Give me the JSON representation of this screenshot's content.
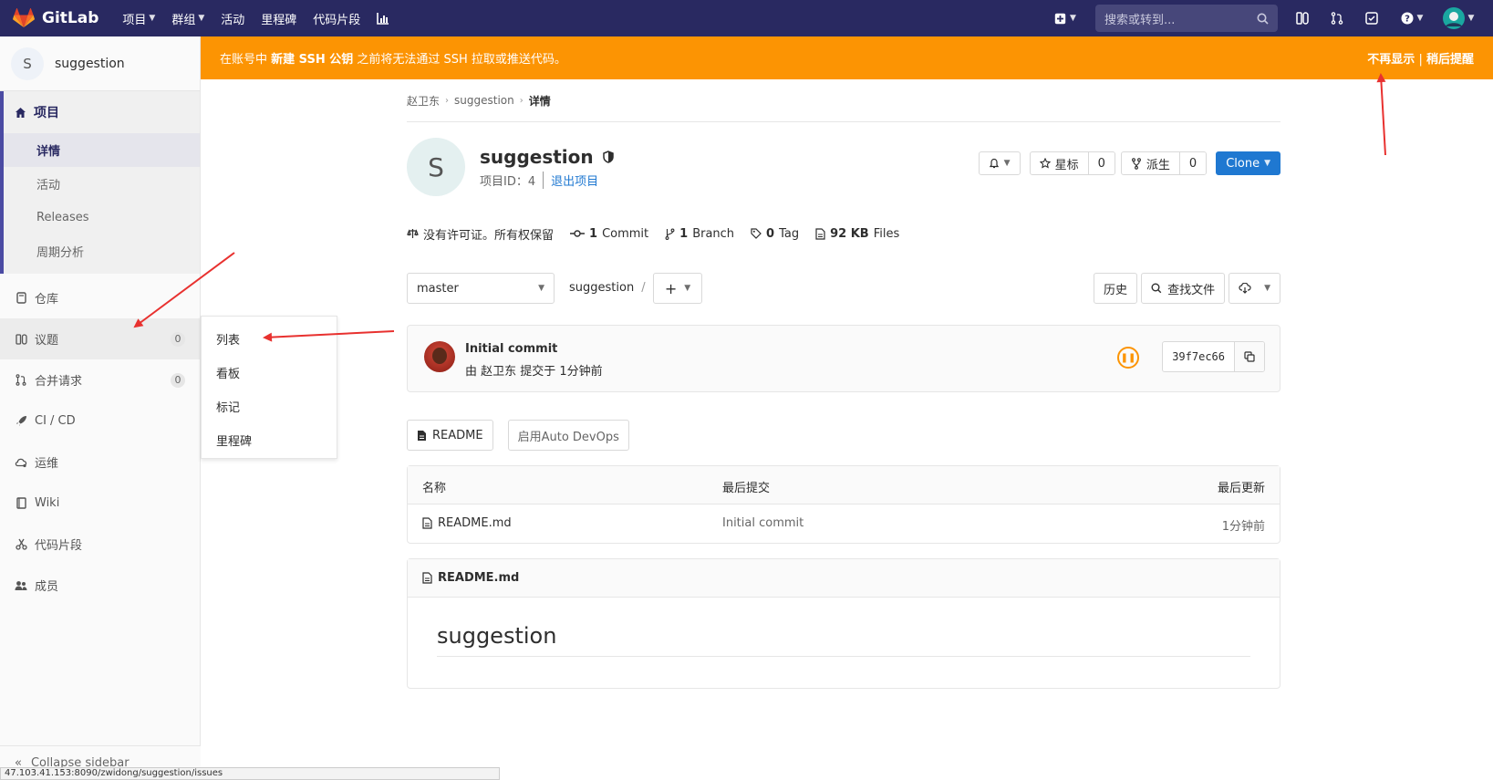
{
  "topnav": {
    "brand": "GitLab",
    "items": [
      {
        "label": "项目",
        "has_dropdown": true
      },
      {
        "label": "群组",
        "has_dropdown": true
      },
      {
        "label": "活动",
        "has_dropdown": false
      },
      {
        "label": "里程碑",
        "has_dropdown": false
      },
      {
        "label": "代码片段",
        "has_dropdown": false
      }
    ],
    "search_placeholder": "搜索或转到..."
  },
  "sidebar": {
    "project_avatar": "S",
    "project_name": "suggestion",
    "section_label": "项目",
    "section_items": [
      {
        "label": "详情",
        "active": true
      },
      {
        "label": "活动",
        "active": false
      },
      {
        "label": "Releases",
        "active": false
      },
      {
        "label": "周期分析",
        "active": false
      }
    ],
    "menu": [
      {
        "label": "仓库",
        "icon": "book-icon"
      },
      {
        "label": "议题",
        "icon": "issues-icon",
        "count": "0"
      },
      {
        "label": "合并请求",
        "icon": "merge-request-icon",
        "count": "0"
      },
      {
        "label": "CI / CD",
        "icon": "rocket-icon"
      },
      {
        "label": "运维",
        "icon": "cloud-gear-icon"
      },
      {
        "label": "Wiki",
        "icon": "wiki-icon"
      },
      {
        "label": "代码片段",
        "icon": "scissors-icon"
      },
      {
        "label": "成员",
        "icon": "users-icon"
      }
    ],
    "collapse_label": "Collapse sidebar"
  },
  "issues_flyout": [
    "列表",
    "看板",
    "标记",
    "里程碑"
  ],
  "banner": {
    "prefix": "在账号中",
    "bold": "新建 SSH 公钥",
    "suffix": "之前将无法通过 SSH 拉取或推送代码。",
    "dismiss": "不再显示",
    "separator": "|",
    "remind": "稍后提醒"
  },
  "breadcrumb": [
    "赵卫东",
    "suggestion",
    "详情"
  ],
  "project": {
    "avatar_letter": "S",
    "name": "suggestion",
    "id_label": "项目ID：",
    "id_value": "4",
    "leave": "退出项目",
    "star_label": "星标",
    "star_count": "0",
    "fork_label": "派生",
    "fork_count": "0",
    "clone_label": "Clone"
  },
  "stats": {
    "license": "没有许可证。所有权保留",
    "commits_num": "1",
    "commits_label": "Commit",
    "branches_num": "1",
    "branches_label": "Branch",
    "tags_num": "0",
    "tags_label": "Tag",
    "files_size": "92 KB",
    "files_label": "Files"
  },
  "toolbar": {
    "branch": "master",
    "path": "suggestion",
    "path_sep": "/",
    "history": "历史",
    "find_file": "查找文件"
  },
  "last_commit": {
    "title": "Initial commit",
    "author_line": "由 赵卫东 提交于 1分钟前",
    "sha": "39f7ec66"
  },
  "quick_actions": {
    "readme": "README",
    "auto_devops": "启用Auto DevOps"
  },
  "file_tree": {
    "headers": {
      "name": "名称",
      "commit": "最后提交",
      "updated": "最后更新"
    },
    "rows": [
      {
        "name": "README.md",
        "commit": "Initial commit",
        "updated": "1分钟前"
      }
    ]
  },
  "readme": {
    "filename": "README.md",
    "heading": "suggestion"
  },
  "status_url": "47.103.41.153:8090/zwidong/suggestion/issues",
  "colors": {
    "topbar": "#292961",
    "banner": "#fc9403",
    "accent": "#1f78d1",
    "annotation_arrow": "#e8312f"
  }
}
